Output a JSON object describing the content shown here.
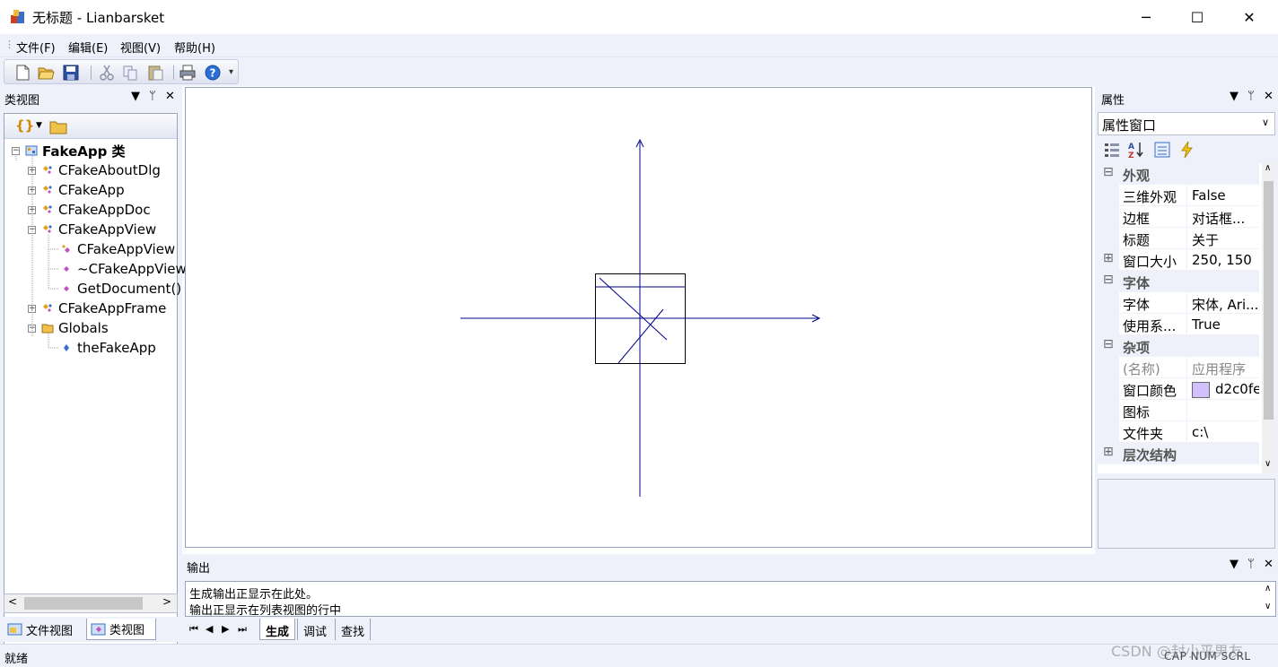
{
  "window": {
    "title": "无标题 - Lianbarsket",
    "controls": [
      "─",
      "☐",
      "✕"
    ]
  },
  "menu": [
    "文件(F)",
    "编辑(E)",
    "视图(V)",
    "帮助(H)"
  ],
  "toolbar": {
    "buttons": [
      "new-file-icon",
      "open-folder-icon",
      "save-icon",
      "cut-icon",
      "copy-icon",
      "paste-icon",
      "print-icon",
      "help-icon"
    ]
  },
  "class_view": {
    "title": "类视图",
    "tree": [
      {
        "label": "FakeApp 类",
        "bold": true
      },
      {
        "label": "CFakeAboutDlg"
      },
      {
        "label": "CFakeApp"
      },
      {
        "label": "CFakeAppDoc"
      },
      {
        "label": "CFakeAppView"
      },
      {
        "label": "CFakeAppView"
      },
      {
        "label": "~CFakeAppView"
      },
      {
        "label": "GetDocument()"
      },
      {
        "label": "CFakeAppFrame"
      },
      {
        "label": "Globals"
      },
      {
        "label": "theFakeApp"
      }
    ],
    "tabs": [
      "文件视图",
      "类视图"
    ]
  },
  "properties": {
    "title": "属性",
    "combo": "属性窗口",
    "rows": [
      {
        "type": "cat",
        "name": "外观",
        "sign": "⊟"
      },
      {
        "name": "三维外观",
        "value": "False"
      },
      {
        "name": "边框",
        "value": "对话框..."
      },
      {
        "name": "标题",
        "value": "关于"
      },
      {
        "name": "窗口大小",
        "value": "250, 150",
        "sign": "⊞"
      },
      {
        "type": "cat",
        "name": "字体",
        "sign": "⊟"
      },
      {
        "name": "字体",
        "value": "宋体, Ari..."
      },
      {
        "name": "使用系...",
        "value": "True"
      },
      {
        "type": "cat",
        "name": "杂项",
        "sign": "⊟"
      },
      {
        "name": "(名称)",
        "value": "应用程序",
        "dim": true
      },
      {
        "name": "窗口颜色",
        "value": "d2c0fe",
        "swatch": "#d2c0fe"
      },
      {
        "name": "图标",
        "value": ""
      },
      {
        "name": "文件夹",
        "value": "c:\\"
      },
      {
        "type": "cat",
        "name": "层次结构",
        "sign": "⊞"
      }
    ]
  },
  "output": {
    "title": "输出",
    "lines": [
      "生成输出正显示在此处。",
      "输出正显示在列表视图的行中"
    ],
    "tabs": [
      "生成",
      "调试",
      "查找"
    ]
  },
  "status": {
    "text": "就绪",
    "indicators": "CAP  NUM  SCRL"
  },
  "watermark": "CSDN @封小平男友",
  "colors": {
    "panel_bg": "#eef0fa",
    "drawing_stroke": "#00008b"
  }
}
